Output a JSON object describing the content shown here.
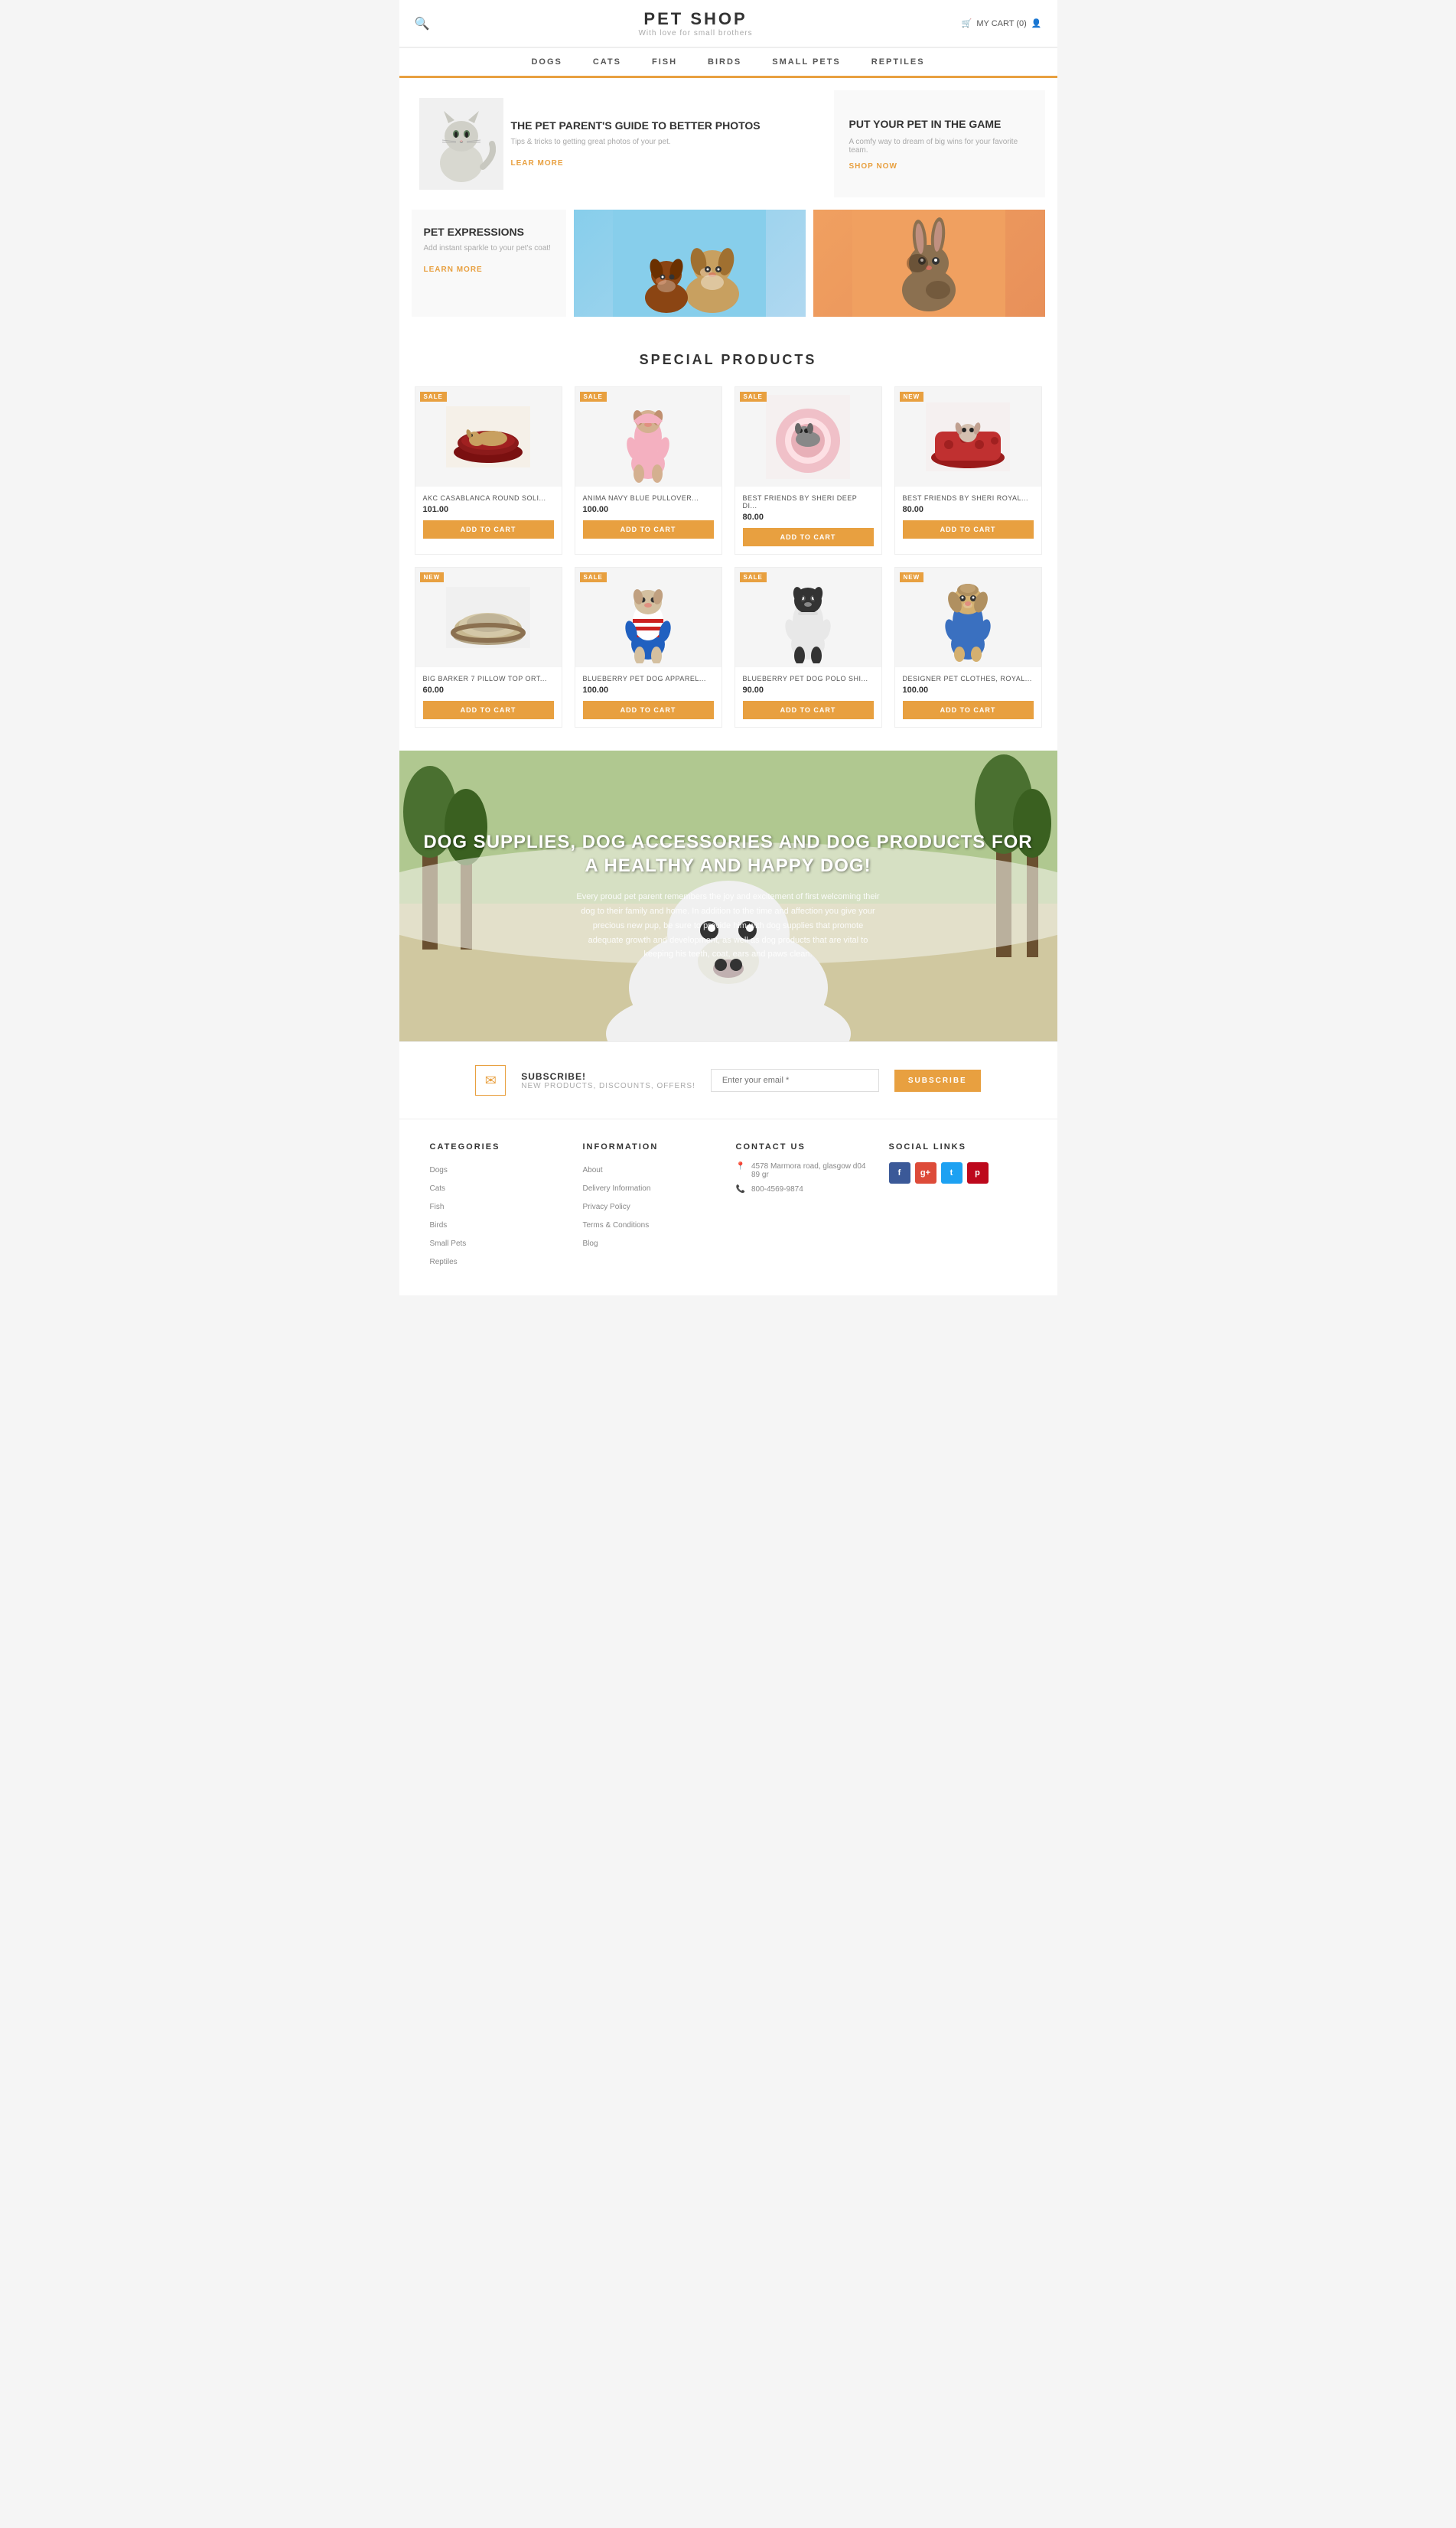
{
  "header": {
    "logo_title": "PET SHOP",
    "logo_subtitle": "With love for small brothers",
    "cart_label": "MY CART (0)"
  },
  "nav": {
    "items": [
      {
        "label": "DOGS",
        "href": "#"
      },
      {
        "label": "CATS",
        "href": "#"
      },
      {
        "label": "FISH",
        "href": "#"
      },
      {
        "label": "BIRDS",
        "href": "#"
      },
      {
        "label": "SMALL PETS",
        "href": "#"
      },
      {
        "label": "REPTILES",
        "href": "#"
      }
    ]
  },
  "hero": {
    "article1": {
      "title": "THE PET PARENT'S GUIDE TO BETTER PHOTOS",
      "desc": "Tips & tricks to getting great photos of your pet.",
      "cta": "LEAR MORE"
    },
    "article2": {
      "title": "PUT YOUR PET IN THE GAME",
      "desc": "A comfy way to dream of big wins for your favorite team.",
      "cta": "SHOP NOW"
    },
    "pet_expressions": {
      "title": "PET EXPRESSIONS",
      "desc": "Add instant sparkle to your pet's coat!",
      "cta": "LEARN MORE"
    }
  },
  "special_products": {
    "section_title": "SPECIAL PRODUCTS",
    "products": [
      {
        "name": "AKC CASABLANCA ROUND SOLI...",
        "price": "101.00",
        "badge": "SALE"
      },
      {
        "name": "ANIMA NAVY BLUE PULLOVER...",
        "price": "100.00",
        "badge": "SALE"
      },
      {
        "name": "BEST FRIENDS BY SHERI DEEP DI...",
        "price": "80.00",
        "badge": "SALE"
      },
      {
        "name": "BEST FRIENDS BY SHERI ROYAL...",
        "price": "80.00",
        "badge": "NEW"
      },
      {
        "name": "BIG BARKER 7 PILLOW TOP ORT...",
        "price": "60.00",
        "badge": "NEW"
      },
      {
        "name": "BLUEBERRY PET DOG APPAREL...",
        "price": "100.00",
        "badge": "SALE"
      },
      {
        "name": "BLUEBERRY PET DOG POLO SHI...",
        "price": "90.00",
        "badge": "SALE"
      },
      {
        "name": "DESIGNER PET CLOTHES, ROYAL...",
        "price": "100.00",
        "badge": "NEW"
      }
    ],
    "add_to_cart_label": "ADD TO CART"
  },
  "dog_banner": {
    "title": "DOG SUPPLIES, DOG ACCESSORIES AND DOG PRODUCTS FOR A HEALTHY AND HAPPY DOG!",
    "desc": "Every proud pet parent remembers the joy and excitement of first welcoming their dog to their family and home. In addition to the time and affection you give your precious new pup, be sure to provide him with dog supplies that promote adequate growth and development, as well as dog products that are vital to keeping his teeth, coat, ears and paws clean."
  },
  "subscribe": {
    "title": "SUBSCRIBE!",
    "subtitle": "NEW PRODUCTS, DISCOUNTS, OFFERS!",
    "placeholder": "Enter your email *",
    "btn_label": "SUBSCRIBE"
  },
  "footer": {
    "categories": {
      "title": "CATEGORIES",
      "items": [
        "Dogs",
        "Cats",
        "Fish",
        "Birds",
        "Small Pets",
        "Reptiles"
      ]
    },
    "information": {
      "title": "INFORMATION",
      "items": [
        "About",
        "Delivery Information",
        "Privacy Policy",
        "Terms & Conditions",
        "Blog"
      ]
    },
    "contact": {
      "title": "CONTACT US",
      "address": "4578 Marmora road, glasgow d04 89 gr",
      "phone": "800-4569-9874"
    },
    "social": {
      "title": "SOCIAL LINKS",
      "links": [
        {
          "label": "f",
          "class": "social-fb"
        },
        {
          "label": "g+",
          "class": "social-gp"
        },
        {
          "label": "t",
          "class": "social-tw"
        },
        {
          "label": "p",
          "class": "social-pi"
        }
      ]
    }
  }
}
